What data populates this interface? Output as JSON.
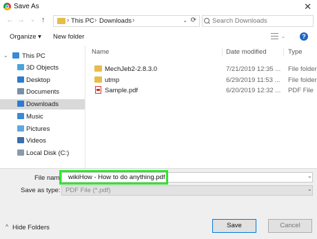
{
  "window": {
    "title": "Save As",
    "close_glyph": "✕"
  },
  "nav": {
    "back_glyph": "←",
    "forward_glyph": "→",
    "dropdown_glyph": "⌄",
    "up_glyph": "↑",
    "path": [
      "This PC",
      "Downloads"
    ],
    "path_sep": "›",
    "search_placeholder": "Search Downloads",
    "refresh_glyph": "⟳"
  },
  "toolbar": {
    "organize_label": "Organize ▾",
    "new_folder_label": "New folder",
    "help_glyph": "?"
  },
  "sidebar": {
    "items": [
      {
        "label": "This PC",
        "icon": "computer-icon",
        "color": "#3a8ad6"
      },
      {
        "label": "3D Objects",
        "icon": "cube-icon",
        "color": "#4aa3df"
      },
      {
        "label": "Desktop",
        "icon": "desktop-icon",
        "color": "#2d7bd1"
      },
      {
        "label": "Documents",
        "icon": "documents-icon",
        "color": "#7a8ea8"
      },
      {
        "label": "Downloads",
        "icon": "download-icon",
        "color": "#2d7bd1"
      },
      {
        "label": "Music",
        "icon": "music-icon",
        "color": "#3a8ad6"
      },
      {
        "label": "Pictures",
        "icon": "pictures-icon",
        "color": "#5fa8e0"
      },
      {
        "label": "Videos",
        "icon": "videos-icon",
        "color": "#3a6fb0"
      },
      {
        "label": "Local Disk (C:)",
        "icon": "disk-icon",
        "color": "#8a9aac"
      }
    ]
  },
  "files": {
    "headers": [
      "Name",
      "Date modified",
      "Type"
    ],
    "rows": [
      {
        "name": "MechJeb2-2.8.3.0",
        "date": "7/21/2019 12:35 ...",
        "type": "File folder",
        "kind": "folder"
      },
      {
        "name": "utmp",
        "date": "6/29/2019 11:53 ...",
        "type": "File folder",
        "kind": "folder"
      },
      {
        "name": "Sample.pdf",
        "date": "6/20/2019 12:32 ...",
        "type": "PDF File",
        "kind": "pdf"
      }
    ]
  },
  "form": {
    "file_name_label": "File name:",
    "file_name_value": "wikiHow - How to do anything.pdf",
    "save_type_label": "Save as type:",
    "save_type_value": "PDF File (*.pdf)",
    "dropdown_glyph": "⌄",
    "hide_folders_label": "Hide Folders",
    "hide_folders_glyph": "^",
    "save_label": "Save",
    "cancel_label": "Cancel"
  },
  "colors": {
    "highlight": "#2ee62e",
    "folder": "#e8bb4a",
    "help": "#2165c2"
  }
}
